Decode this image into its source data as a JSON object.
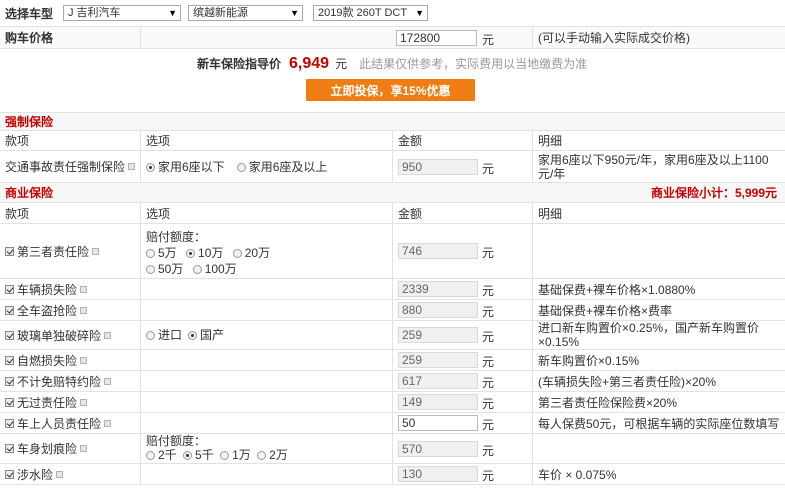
{
  "header": {
    "select_label": "选择车型",
    "brand": "J 吉利汽车",
    "series": "缤越新能源",
    "model": "2019款 260T DCT",
    "price_label": "购车价格",
    "price_value": "172800",
    "price_unit": "元",
    "price_note": "(可以手动输入实际成交价格)",
    "guide_label": "新车保险指导价",
    "guide_value": "6,949",
    "guide_unit": "元",
    "guide_note": "此结果仅供参考，实际费用以当地缴费为准",
    "cta_label": "立即投保，享15%优惠"
  },
  "compulsory": {
    "title": "强制保险",
    "columns": [
      "款项",
      "选项",
      "金额",
      "明细"
    ],
    "row": {
      "name": "交通事故责任强制保险",
      "opt1": "家用6座以下",
      "opt2": "家用6座及以上",
      "amount": "950",
      "unit": "元",
      "detail": "家用6座以下950元/年，家用6座及以上1100元/年"
    }
  },
  "commercial": {
    "title": "商业保险",
    "subtotal_label": "商业保险小计：",
    "subtotal_value": "5,999元",
    "columns": [
      "款项",
      "选项",
      "金额",
      "明细"
    ],
    "rows": [
      {
        "name": "第三者责任险",
        "amount": "746",
        "unit": "元",
        "detail": "",
        "opt_title": "赔付额度：",
        "opts_line1": [
          "5万",
          "10万",
          "20万"
        ],
        "opts_line2": [
          "50万",
          "100万"
        ],
        "selected": "10万"
      },
      {
        "name": "车辆损失险",
        "amount": "2339",
        "unit": "元",
        "detail": "基础保费+裸车价格×1.0880%"
      },
      {
        "name": "全车盗抢险",
        "amount": "880",
        "unit": "元",
        "detail": "基础保费+裸车价格×费率"
      },
      {
        "name": "玻璃单独破碎险",
        "amount": "259",
        "unit": "元",
        "detail": "进口新车购置价×0.25%，国产新车购置价×0.15%",
        "opts": [
          "进口",
          "国产"
        ],
        "selected": "国产"
      },
      {
        "name": "自燃损失险",
        "amount": "259",
        "unit": "元",
        "detail": "新车购置价×0.15%"
      },
      {
        "name": "不计免赔特约险",
        "amount": "617",
        "unit": "元",
        "detail": "(车辆损失险+第三者责任险)×20%"
      },
      {
        "name": "无过责任险",
        "amount": "149",
        "unit": "元",
        "detail": "第三者责任险保险费×20%"
      },
      {
        "name": "车上人员责任险",
        "amount": "50",
        "unit": "元",
        "detail": "每人保费50元，可根据车辆的实际座位数填写"
      },
      {
        "name": "车身划痕险",
        "amount": "570",
        "unit": "元",
        "detail": "",
        "opt_title": "赔付额度：",
        "opts_line1": [
          "2千",
          "5千",
          "1万",
          "2万"
        ],
        "selected": "5千"
      },
      {
        "name": "涉水险",
        "amount": "130",
        "unit": "元",
        "detail": "车价 × 0.075%"
      }
    ]
  },
  "colors": {
    "accent_red": "#c40000",
    "button_orange": "#ef7d14",
    "border": "#e2e2e2"
  }
}
